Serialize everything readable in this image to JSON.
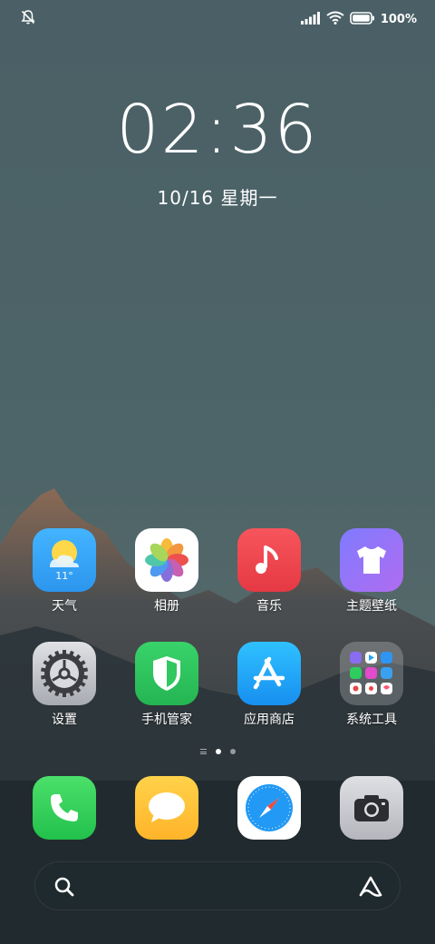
{
  "status_bar": {
    "left_icon": "silent-bell-icon",
    "signal_icon": "signal-icon",
    "wifi_icon": "wifi-icon",
    "battery_icon": "battery-icon",
    "battery_percent": "100%"
  },
  "clock": {
    "time": "02:36",
    "date": "10/16 星期一"
  },
  "apps": [
    {
      "label": "天气",
      "icon": "weather-icon",
      "temp": "11°"
    },
    {
      "label": "相册",
      "icon": "photos-icon"
    },
    {
      "label": "音乐",
      "icon": "music-icon"
    },
    {
      "label": "主题壁纸",
      "icon": "themes-icon"
    },
    {
      "label": "设置",
      "icon": "settings-icon"
    },
    {
      "label": "手机管家",
      "icon": "security-icon"
    },
    {
      "label": "应用商店",
      "icon": "app-store-icon"
    },
    {
      "label": "系统工具",
      "icon": "folder-icon"
    }
  ],
  "dock": [
    {
      "icon": "phone-icon"
    },
    {
      "icon": "messages-icon"
    },
    {
      "icon": "browser-icon"
    },
    {
      "icon": "camera-icon"
    }
  ],
  "page_indicator": {
    "pages": 2,
    "active": 1
  },
  "search": {
    "search_icon": "search-icon",
    "assistant_icon": "assistant-icon"
  },
  "colors": {
    "weather": "#3aa5f5",
    "music": "#f0474f",
    "themes": "#9b6cf5",
    "security": "#2ec25a",
    "app_store": "#1aa9f5",
    "phone": "#3ed35a",
    "messages": "#ffc23a"
  }
}
